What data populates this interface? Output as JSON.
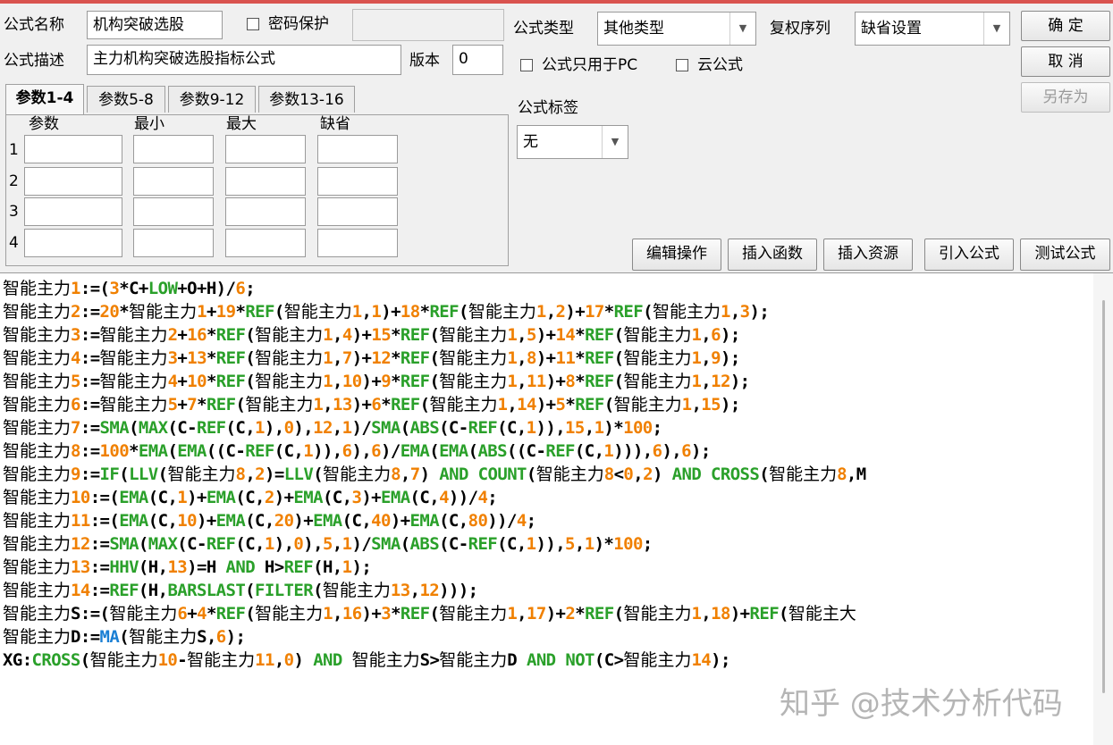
{
  "header": {
    "name_label": "公式名称",
    "name_value": "机构突破选股",
    "password_label": "密码保护",
    "desc_label": "公式描述",
    "desc_value": "主力机构突破选股指标公式",
    "version_label": "版本",
    "version_value": "0",
    "type_label": "公式类型",
    "type_value": "其他类型",
    "adjust_label": "复权序列",
    "adjust_value": "缺省设置",
    "pc_only_label": "公式只用于PC",
    "cloud_label": "云公式",
    "tag_label": "公式标签",
    "tag_value": "无"
  },
  "buttons": {
    "ok": "确  定",
    "cancel": "取  消",
    "save_as": "另存为",
    "edit_ops": "编辑操作",
    "insert_func": "插入函数",
    "insert_resource": "插入资源",
    "import_formula": "引入公式",
    "test_formula": "测试公式"
  },
  "params": {
    "tabs": [
      "参数1-4",
      "参数5-8",
      "参数9-12",
      "参数13-16"
    ],
    "columns": [
      "参数",
      "最小",
      "最大",
      "缺省"
    ],
    "rows": [
      "1",
      "2",
      "3",
      "4"
    ]
  },
  "code_lines": [
    "智能主力1:=(3*C+LOW+O+H)/6;",
    "智能主力2:=20*智能主力1+19*REF(智能主力1,1)+18*REF(智能主力1,2)+17*REF(智能主力1,3);",
    "智能主力3:=智能主力2+16*REF(智能主力1,4)+15*REF(智能主力1,5)+14*REF(智能主力1,6);",
    "智能主力4:=智能主力3+13*REF(智能主力1,7)+12*REF(智能主力1,8)+11*REF(智能主力1,9);",
    "智能主力5:=智能主力4+10*REF(智能主力1,10)+9*REF(智能主力1,11)+8*REF(智能主力1,12);",
    "智能主力6:=智能主力5+7*REF(智能主力1,13)+6*REF(智能主力1,14)+5*REF(智能主力1,15);",
    "智能主力7:=SMA(MAX(C-REF(C,1),0),12,1)/SMA(ABS(C-REF(C,1)),15,1)*100;",
    "智能主力8:=100*EMA(EMA((C-REF(C,1)),6),6)/EMA(EMA(ABS((C-REF(C,1))),6),6);",
    "智能主力9:=IF(LLV(智能主力8,2)=LLV(智能主力8,7) AND COUNT(智能主力8<0,2) AND CROSS(智能主力8,M",
    "智能主力10:=(EMA(C,1)+EMA(C,2)+EMA(C,3)+EMA(C,4))/4;",
    "智能主力11:=(EMA(C,10)+EMA(C,20)+EMA(C,40)+EMA(C,80))/4;",
    "智能主力12:=SMA(MAX(C-REF(C,1),0),5,1)/SMA(ABS(C-REF(C,1)),5,1)*100;",
    "智能主力13:=HHV(H,13)=H AND H>REF(H,1);",
    "智能主力14:=REF(H,BARSLAST(FILTER(智能主力13,12)));",
    "智能主力S:=(智能主力6+4*REF(智能主力1,16)+3*REF(智能主力1,17)+2*REF(智能主力1,18)+REF(智能主大",
    "智能主力D:=MA(智能主力S,6);",
    "XG:CROSS(智能主力10-智能主力11,0) AND 智能主力S>智能主力D AND NOT(C>智能主力14);"
  ],
  "watermark": "知乎 @技术分析代码",
  "colors": {
    "function": "#2aa02a",
    "number": "#f08000",
    "ma_function": "#1a7fd4",
    "top_accent": "#d9534f"
  }
}
